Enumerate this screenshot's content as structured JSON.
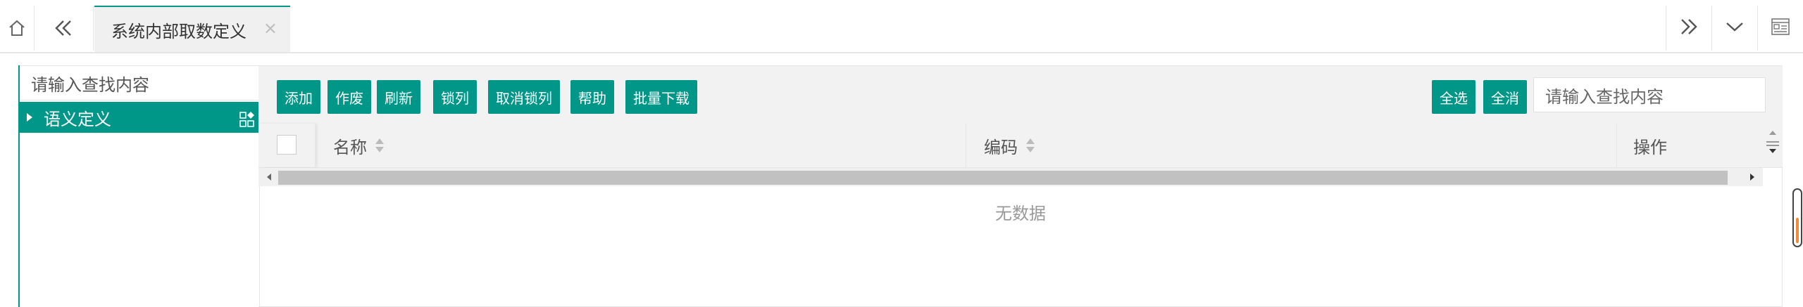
{
  "tabs": {
    "active_label": "系统内部取数定义",
    "close_glyph": "×"
  },
  "tree": {
    "search_placeholder": "请输入查找内容",
    "items": [
      {
        "label": "语义定义",
        "expanded": false,
        "selected": true
      }
    ]
  },
  "toolbar": {
    "buttons": [
      "添加",
      "作废",
      "刷新",
      "锁列",
      "取消锁列",
      "帮助",
      "批量下载"
    ],
    "select_all": "全选",
    "deselect_all": "全消",
    "search_placeholder": "请输入查找内容"
  },
  "table": {
    "columns": [
      "名称",
      "编码",
      "操作"
    ],
    "empty_text": "无数据"
  },
  "colors": {
    "accent": "#009688",
    "scroll_indicator": "#f08a3c"
  },
  "icons": [
    "home-icon",
    "double-chevron-left-icon",
    "close-icon",
    "double-chevron-right-icon",
    "chevron-down-icon",
    "window-icon",
    "tree-caret-right-icon",
    "tree-ops-icon",
    "sort-icon"
  ]
}
